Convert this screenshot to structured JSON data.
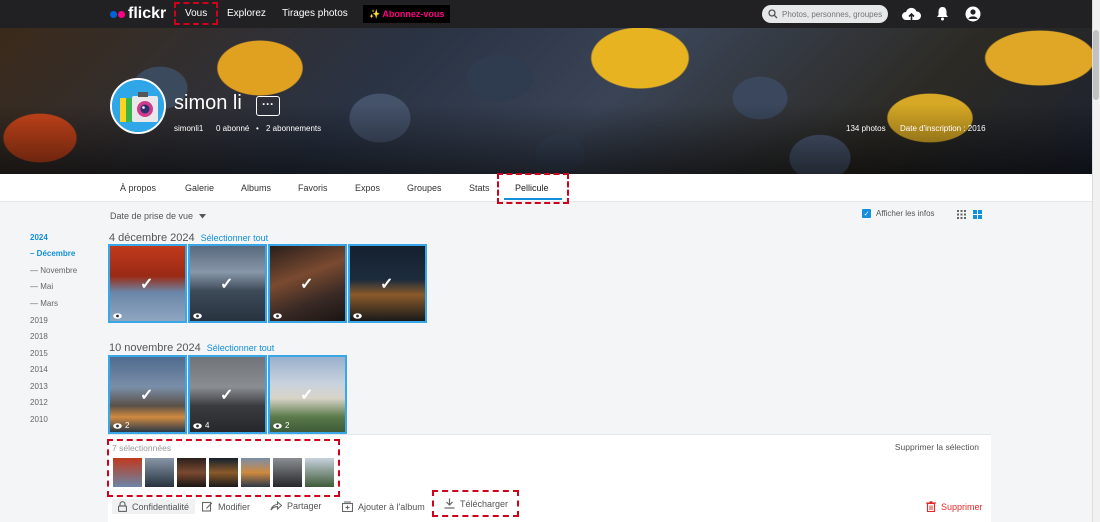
{
  "topbar": {
    "logo": "flickr",
    "nav": [
      "Vous",
      "Explorez",
      "Tirages photos"
    ],
    "upsell": "✨ Abonnez-vous",
    "search_placeholder": "Photos, personnes, groupes",
    "icons": [
      "upload-icon",
      "bell-icon",
      "user-icon"
    ]
  },
  "profile": {
    "name": "simon li",
    "more": "···",
    "username": "simonli1",
    "followers": "0 abonné",
    "following": "2 abonnements",
    "photos_count": "134 photos",
    "joined": "Date d'inscription : 2016"
  },
  "tabs": [
    "À propos",
    "Galerie",
    "Albums",
    "Favoris",
    "Expos",
    "Groupes",
    "Stats",
    "Pellicule"
  ],
  "active_tab": "Pellicule",
  "toolbar": {
    "sort": "Date de prise de vue",
    "show_info": "Afficher les infos"
  },
  "timeline": {
    "active_year": "2024",
    "active_month": "Décembre",
    "months": [
      "Novembre",
      "Mai",
      "Mars"
    ],
    "years": [
      "2019",
      "2018",
      "2015",
      "2014",
      "2013",
      "2012",
      "2010"
    ]
  },
  "groups": [
    {
      "date": "4 décembre 2024",
      "select_all": "Sélectionner tout",
      "photos": [
        {
          "views": ""
        },
        {
          "views": ""
        },
        {
          "views": ""
        },
        {
          "views": ""
        }
      ]
    },
    {
      "date": "10 novembre 2024",
      "select_all": "Sélectionner tout",
      "photos": [
        {
          "views": "2"
        },
        {
          "views": "4"
        },
        {
          "views": "2"
        }
      ]
    }
  ],
  "selection": {
    "count": "7 sélectionnées",
    "clear": "Supprimer la sélection",
    "actions": {
      "privacy": "Confidentialité",
      "edit": "Modifier",
      "share": "Partager",
      "add_album": "Ajouter à l'album",
      "download": "Télécharger",
      "delete": "Supprimer"
    }
  },
  "colors": {
    "accent": "#128fdc",
    "brand_pink": "#ff0084",
    "brand_blue": "#0063dc",
    "danger": "#e0292a"
  }
}
